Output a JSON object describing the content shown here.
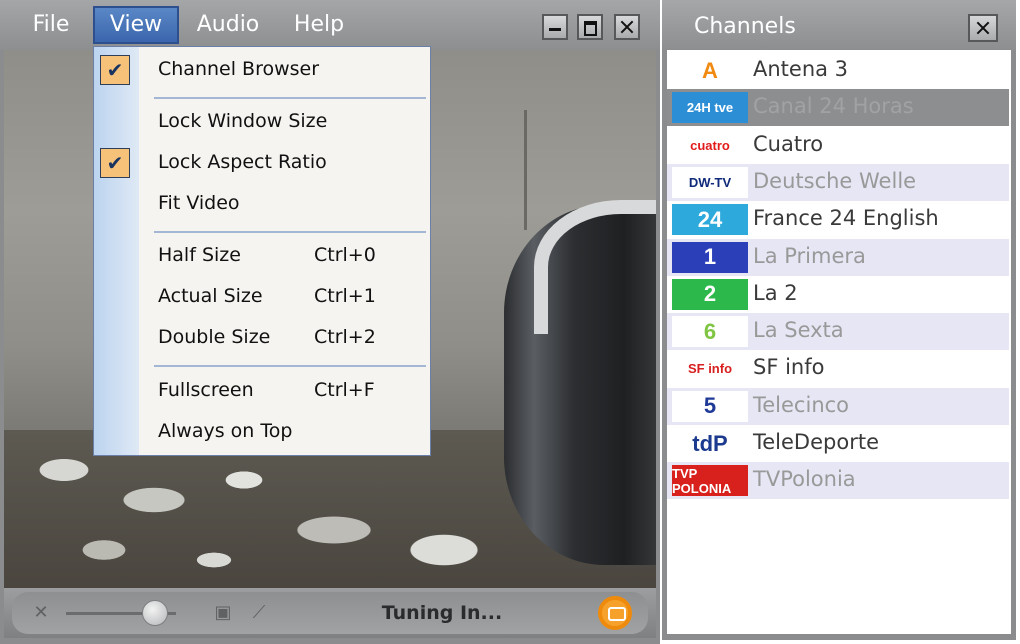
{
  "menubar": {
    "file": "File",
    "view": "View",
    "audio": "Audio",
    "help": "Help"
  },
  "view_menu": {
    "items": [
      {
        "label": "Channel Browser",
        "shortcut": "",
        "checked": true
      },
      {
        "label": "Lock Window Size",
        "shortcut": "",
        "checked": false
      },
      {
        "label": "Lock Aspect Ratio",
        "shortcut": "",
        "checked": true
      },
      {
        "label": "Fit Video",
        "shortcut": "",
        "checked": false
      },
      {
        "label": "Half Size",
        "shortcut": "Ctrl+0",
        "checked": false
      },
      {
        "label": "Actual Size",
        "shortcut": "Ctrl+1",
        "checked": false
      },
      {
        "label": "Double Size",
        "shortcut": "Ctrl+2",
        "checked": false
      },
      {
        "label": "Fullscreen",
        "shortcut": "Ctrl+F",
        "checked": false
      },
      {
        "label": "Always on Top",
        "shortcut": "",
        "checked": false
      }
    ],
    "check_glyph": "✔"
  },
  "controls": {
    "status": "Tuning In...",
    "volume_level": 0.8
  },
  "channels": {
    "title": "Channels",
    "items": [
      {
        "name": "Antena 3",
        "logo_text": "A",
        "logo_bg": "#ffffff",
        "logo_fg": "#f08a10",
        "state": "normal"
      },
      {
        "name": "Canal 24 Horas",
        "logo_text": "24H tve",
        "logo_bg": "#2c8fd6",
        "logo_fg": "#ffffff",
        "state": "selected"
      },
      {
        "name": "Cuatro",
        "logo_text": "cuatro",
        "logo_bg": "#ffffff",
        "logo_fg": "#e21b1b",
        "state": "normal"
      },
      {
        "name": "Deutsche Welle",
        "logo_text": "DW-TV",
        "logo_bg": "#ffffff",
        "logo_fg": "#0f2a7a",
        "state": "shade"
      },
      {
        "name": "France 24 English",
        "logo_text": "24",
        "logo_bg": "#2da9dc",
        "logo_fg": "#ffffff",
        "state": "normal"
      },
      {
        "name": "La Primera",
        "logo_text": "1",
        "logo_bg": "#2b3fb8",
        "logo_fg": "#ffffff",
        "state": "shade"
      },
      {
        "name": "La 2",
        "logo_text": "2",
        "logo_bg": "#2cb84a",
        "logo_fg": "#ffffff",
        "state": "normal"
      },
      {
        "name": "La Sexta",
        "logo_text": "6",
        "logo_bg": "#ffffff",
        "logo_fg": "#7fc542",
        "state": "shade"
      },
      {
        "name": "SF info",
        "logo_text": "SF info",
        "logo_bg": "#ffffff",
        "logo_fg": "#d81f1f",
        "state": "normal"
      },
      {
        "name": "Telecinco",
        "logo_text": "5",
        "logo_bg": "#ffffff",
        "logo_fg": "#1f3a96",
        "state": "shade"
      },
      {
        "name": "TeleDeporte",
        "logo_text": "tdP",
        "logo_bg": "#ffffff",
        "logo_fg": "#1c3b8f",
        "state": "normal"
      },
      {
        "name": "TVPolonia",
        "logo_text": "TVP POLONIA",
        "logo_bg": "#d8211c",
        "logo_fg": "#ffffff",
        "state": "shade"
      }
    ]
  }
}
